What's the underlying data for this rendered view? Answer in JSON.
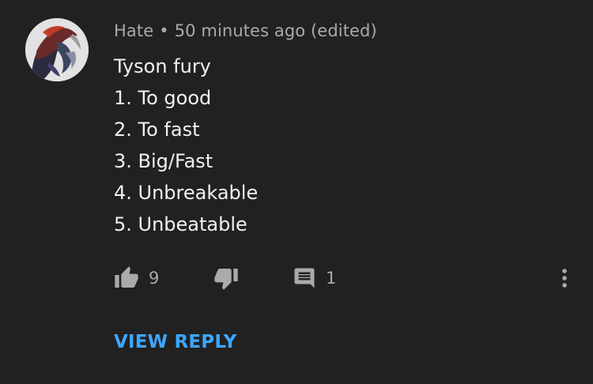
{
  "comment": {
    "author": "Hate",
    "separator": "•",
    "timestamp": "50 minutes ago (edited)",
    "lines": [
      "Tyson fury",
      "1. To good",
      "2. To fast",
      "3. Big/Fast",
      "4. Unbreakable",
      "5. Unbeatable"
    ]
  },
  "actions": {
    "like_icon": "thumb-up-icon",
    "like_count": "9",
    "dislike_icon": "thumb-down-icon",
    "reply_icon": "comment-icon",
    "reply_count": "1",
    "more_icon": "more-vertical-icon"
  },
  "view_reply_label": "VIEW REPLY",
  "colors": {
    "background": "#212121",
    "primary_text": "#f1f1f1",
    "secondary_text": "#aaaaaa",
    "link": "#3ea6ff"
  }
}
